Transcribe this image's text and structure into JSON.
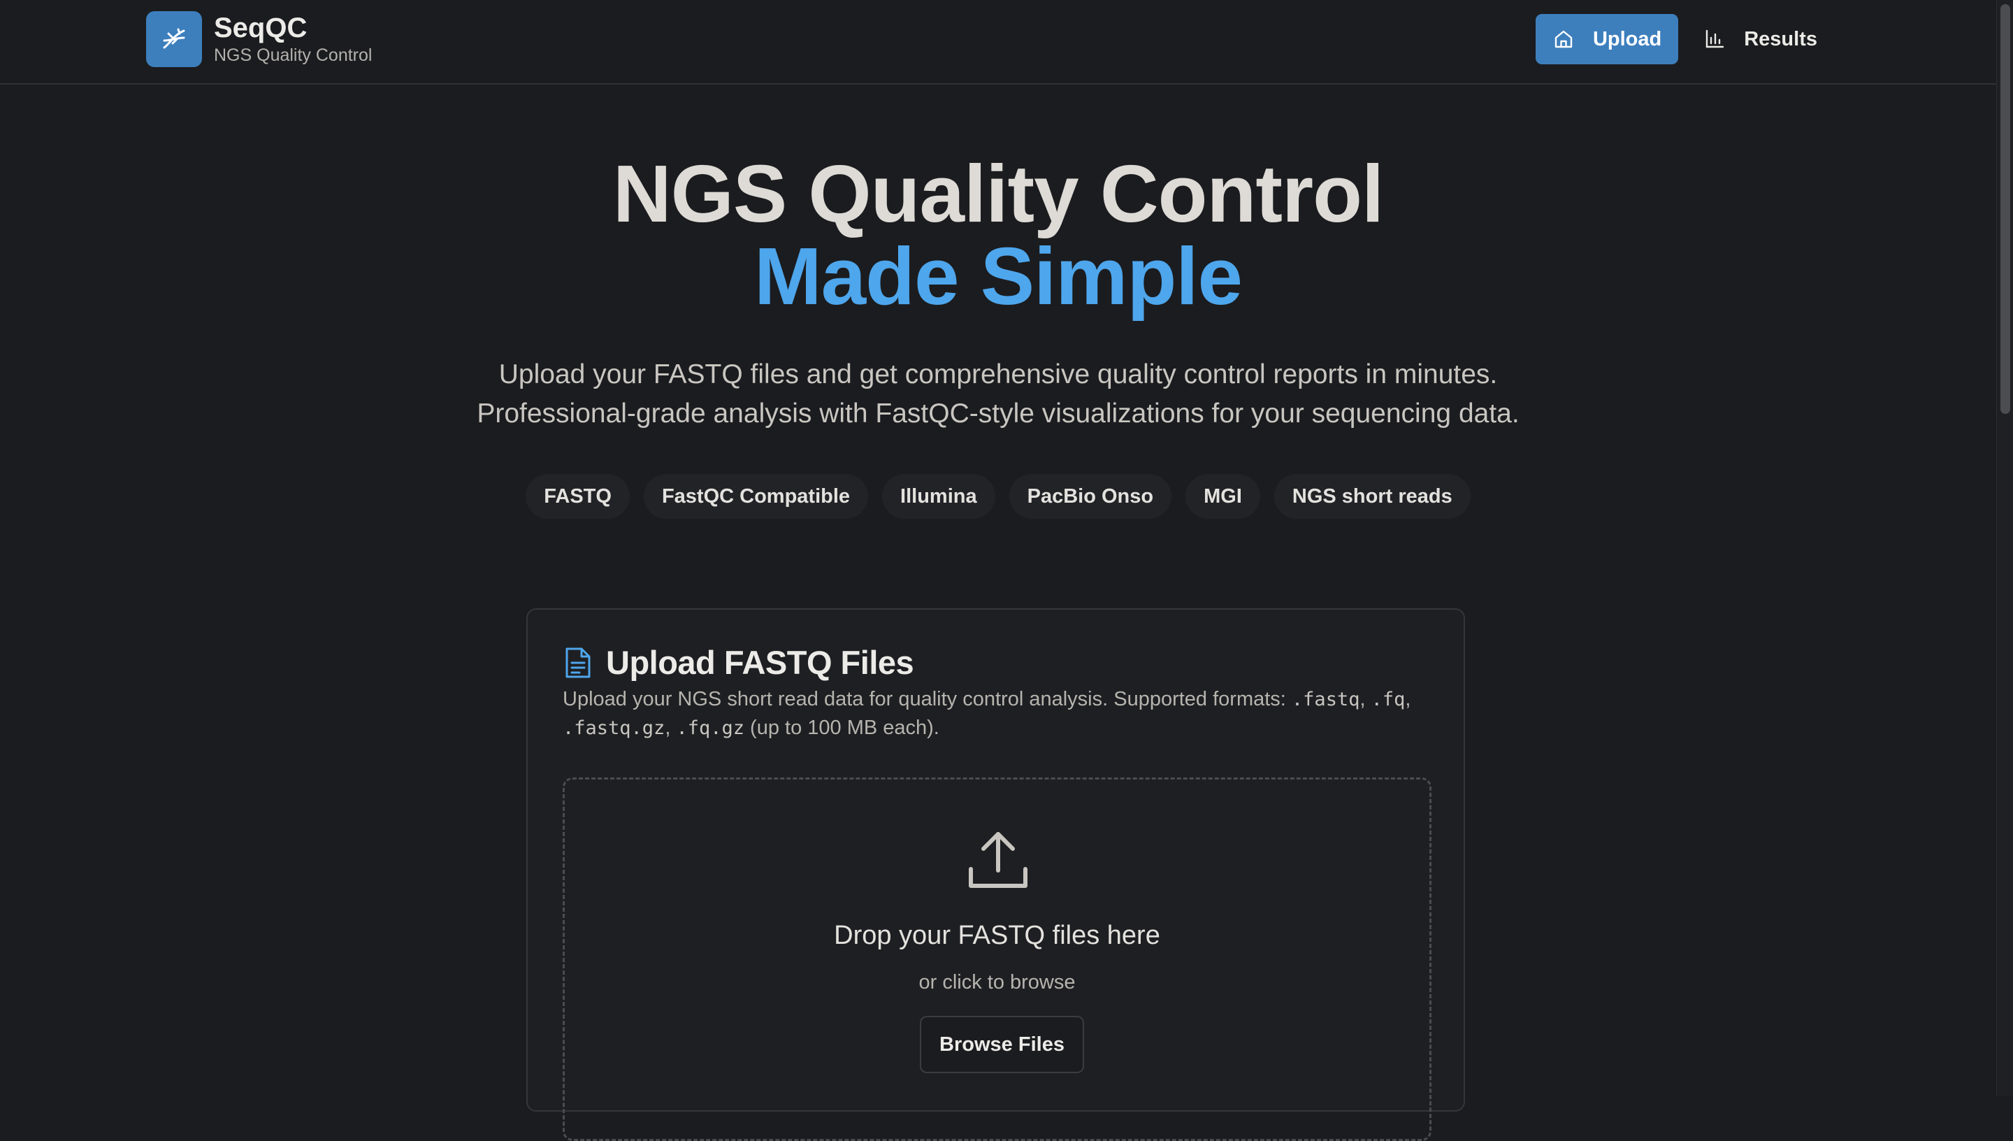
{
  "brand": {
    "name": "SeqQC",
    "subtitle": "NGS Quality Control",
    "logo_icon": "dna-icon",
    "accent_color": "#3d7fbd"
  },
  "nav": {
    "items": [
      {
        "label": "Upload",
        "icon": "home-icon",
        "active": true
      },
      {
        "label": "Results",
        "icon": "bar-chart-icon",
        "active": false
      }
    ]
  },
  "hero": {
    "title_line1": "NGS Quality Control",
    "title_line2": "Made Simple",
    "title_accent_color": "#4ea6ec",
    "subtitle_line1": "Upload your FASTQ files and get comprehensive quality control reports in minutes.",
    "subtitle_line2": "Professional-grade analysis with FastQC-style visualizations for your sequencing data."
  },
  "tags": [
    "FASTQ",
    "FastQC Compatible",
    "Illumina",
    "PacBio Onso",
    "MGI",
    "NGS short reads"
  ],
  "upload_card": {
    "icon": "file-text-icon",
    "title": "Upload FASTQ Files",
    "desc_prefix": "Upload your NGS short read data for quality control analysis. Supported formats: ",
    "formats": [
      ".fastq",
      ".fq",
      ".fastq.gz",
      ".fq.gz"
    ],
    "sep": ", ",
    "desc_suffix": " (up to 100 MB each).",
    "dropzone": {
      "icon": "upload-icon",
      "title": "Drop your FASTQ files here",
      "subtitle": "or click to browse",
      "button_label": "Browse Files"
    }
  }
}
